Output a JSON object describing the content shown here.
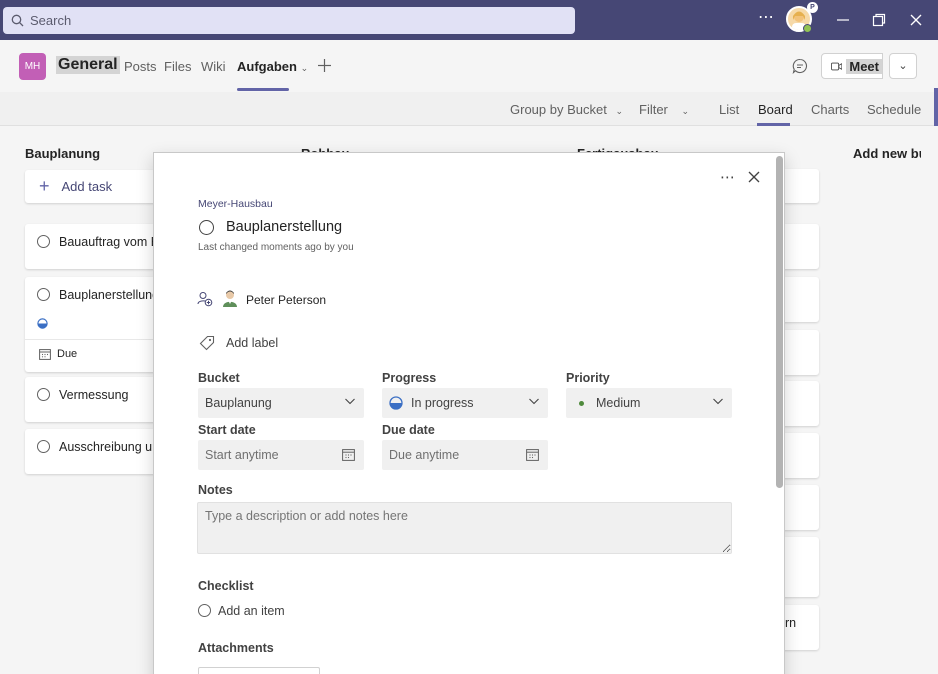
{
  "titlebar": {
    "search_placeholder": "Search",
    "more_icon": "ellipsis-icon",
    "avatar_badge": "P",
    "window_controls": [
      "minimize-icon",
      "restore-icon",
      "close-icon"
    ]
  },
  "channel": {
    "team_initials": "MH",
    "name": "General",
    "tabs": [
      "Posts",
      "Files",
      "Wiki",
      "Aufgaben"
    ],
    "active_tab": "Aufgaben",
    "meet_label": "Meet"
  },
  "planner_bar": {
    "group_by": "Group by Bucket",
    "filter": "Filter",
    "views": [
      "List",
      "Board",
      "Charts",
      "Schedule"
    ],
    "active_view": "Board"
  },
  "board": {
    "buckets": [
      "Bauplanung",
      "Rohbau",
      "Fertigausbau",
      "Add new bu"
    ],
    "add_task_label": "Add task",
    "tasks": [
      {
        "title": "Bauauftrag vom Ba"
      },
      {
        "title": "Bauplanerstellung",
        "due_label": "Due"
      },
      {
        "title": "Vermessung"
      },
      {
        "title": "Ausschreibung un"
      }
    ],
    "right_card_text": "rn"
  },
  "task_detail": {
    "plan_name": "Meyer-Hausbau",
    "title": "Bauplanerstellung",
    "last_changed": "Last changed moments ago by you",
    "assignee": "Peter Peterson",
    "add_label": "Add label",
    "fields": {
      "bucket_label": "Bucket",
      "bucket_value": "Bauplanung",
      "progress_label": "Progress",
      "progress_value": "In progress",
      "priority_label": "Priority",
      "priority_value": "Medium",
      "start_label": "Start date",
      "start_placeholder": "Start anytime",
      "due_label": "Due date",
      "due_placeholder": "Due anytime"
    },
    "notes_label": "Notes",
    "notes_placeholder": "Type a description or add notes here",
    "checklist_label": "Checklist",
    "add_item": "Add an item",
    "attachments_label": "Attachments"
  },
  "colors": {
    "titlebar": "#464775",
    "accent": "#6264a7",
    "team_avatar": "#c25fb6",
    "priority_dot": "#4f8a3c"
  }
}
